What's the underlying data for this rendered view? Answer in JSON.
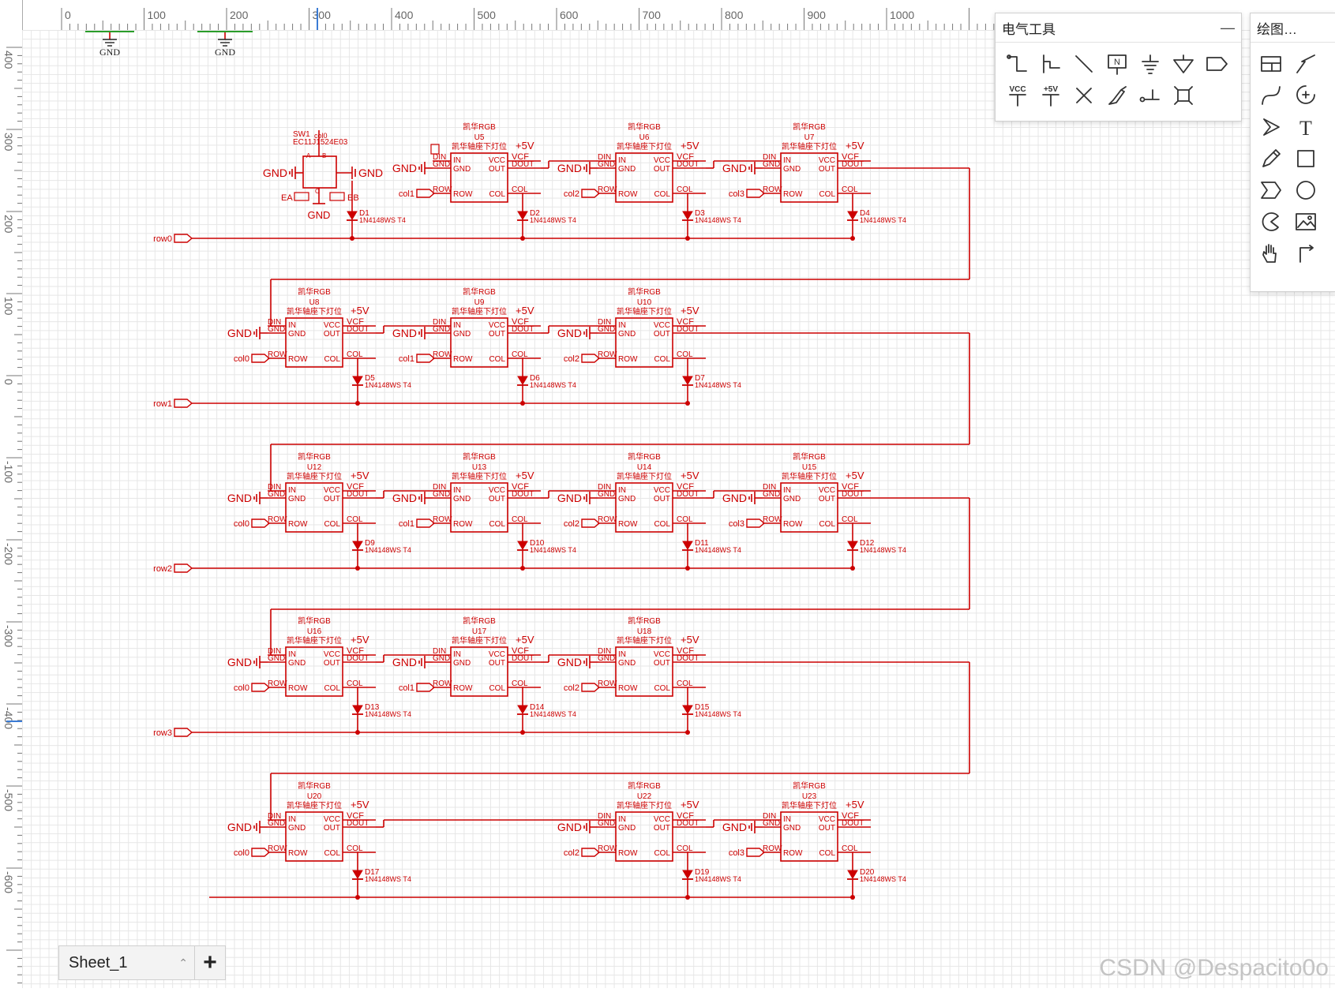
{
  "ruler": {
    "top_labels": [
      "0",
      "100",
      "200",
      "300",
      "400",
      "500",
      "600",
      "700",
      "800",
      "900",
      "1000"
    ],
    "left_labels": [
      "400",
      "300",
      "200",
      "100",
      "0",
      "-100",
      "-200",
      "-300",
      "-400",
      "-500",
      "-600"
    ]
  },
  "electrical_panel": {
    "title": "电气工具",
    "minimize_symbol": "—",
    "tools": [
      {
        "icon": "wire-icon"
      },
      {
        "icon": "bus-entry-icon"
      },
      {
        "icon": "bus-icon"
      },
      {
        "icon": "net-label-icon",
        "text": "N"
      },
      {
        "icon": "ground-icon"
      },
      {
        "icon": "signal-ground-icon"
      },
      {
        "icon": "net-port-icon"
      },
      {
        "icon": "vcc-icon",
        "text": "VCC"
      },
      {
        "icon": "plus5v-icon",
        "text": "+5V"
      },
      {
        "icon": "no-connect-icon"
      },
      {
        "icon": "probe-icon"
      },
      {
        "icon": "pin-icon"
      },
      {
        "icon": "component-icon"
      }
    ]
  },
  "drawing_panel": {
    "title": "绘图…",
    "tools": [
      {
        "icon": "table-icon"
      },
      {
        "icon": "polyline-icon"
      },
      {
        "icon": "bezier-icon"
      },
      {
        "icon": "arc-icon"
      },
      {
        "icon": "arrow-icon"
      },
      {
        "icon": "text-icon",
        "text": "T"
      },
      {
        "icon": "pencil-icon"
      },
      {
        "icon": "rectangle-icon"
      },
      {
        "icon": "pentagon-arrow-icon"
      },
      {
        "icon": "circle-icon"
      },
      {
        "icon": "pie-icon"
      },
      {
        "icon": "image-icon"
      },
      {
        "icon": "hand-icon"
      },
      {
        "icon": "dimension-icon"
      }
    ]
  },
  "sheet_tab": {
    "name": "Sheet_1",
    "add_label": "+"
  },
  "watermark": "CSDN @Despacito0o",
  "schematic": {
    "wire_color": "#cc0000",
    "top_gnd_labels": [
      "GND",
      "GND"
    ],
    "encoder": {
      "ref": "SW1",
      "part": "EC11J1524E03",
      "pin_label": "col0",
      "gnd_left": "GND",
      "gnd_right": "GND",
      "gnd_bottom": "GND",
      "ea": "EA",
      "eb": "EB",
      "pin_a": "A",
      "pin_b": "B",
      "pin_c": "C"
    },
    "pin_labels": {
      "din": "DIN",
      "gnd": "GND",
      "in": "IN",
      "vcc": "VCC",
      "out": "OUT",
      "vcf": "VCF",
      "dout": "DOUT",
      "row": "ROW",
      "col": "COL",
      "plus5v": "+5V"
    },
    "led_type": "凯华RGB",
    "led_desc": "凯华轴座下灯位",
    "diode_part": "1N4148WS T4",
    "gnd_label": "GND",
    "rows": [
      {
        "net": "row0",
        "cells": [
          null,
          {
            "u": "U5",
            "d": "D2",
            "col": "col1"
          },
          {
            "u": "U6",
            "d": "D3",
            "col": "col2"
          },
          {
            "u": "U7",
            "d": "D4",
            "col": "col3"
          }
        ],
        "first_diode": "D1"
      },
      {
        "net": "row1",
        "cells": [
          {
            "u": "U8",
            "d": "D5",
            "col": "col0"
          },
          {
            "u": "U9",
            "d": "D6",
            "col": "col1"
          },
          {
            "u": "U10",
            "d": "D7",
            "col": "col2"
          },
          null
        ]
      },
      {
        "net": "row2",
        "cells": [
          {
            "u": "U12",
            "d": "D9",
            "col": "col0"
          },
          {
            "u": "U13",
            "d": "D10",
            "col": "col1"
          },
          {
            "u": "U14",
            "d": "D11",
            "col": "col2"
          },
          {
            "u": "U15",
            "d": "D12",
            "col": "col3"
          }
        ]
      },
      {
        "net": "row3",
        "cells": [
          {
            "u": "U16",
            "d": "D13",
            "col": "col0"
          },
          {
            "u": "U17",
            "d": "D14",
            "col": "col1"
          },
          {
            "u": "U18",
            "d": "D15",
            "col": "col2"
          },
          null
        ]
      },
      {
        "net": "",
        "cells": [
          {
            "u": "U20",
            "d": "D17",
            "col": "col0"
          },
          null,
          {
            "u": "U22",
            "d": "D19",
            "col": "col2"
          },
          {
            "u": "U23",
            "d": "D20",
            "col": "col3"
          }
        ]
      }
    ]
  }
}
